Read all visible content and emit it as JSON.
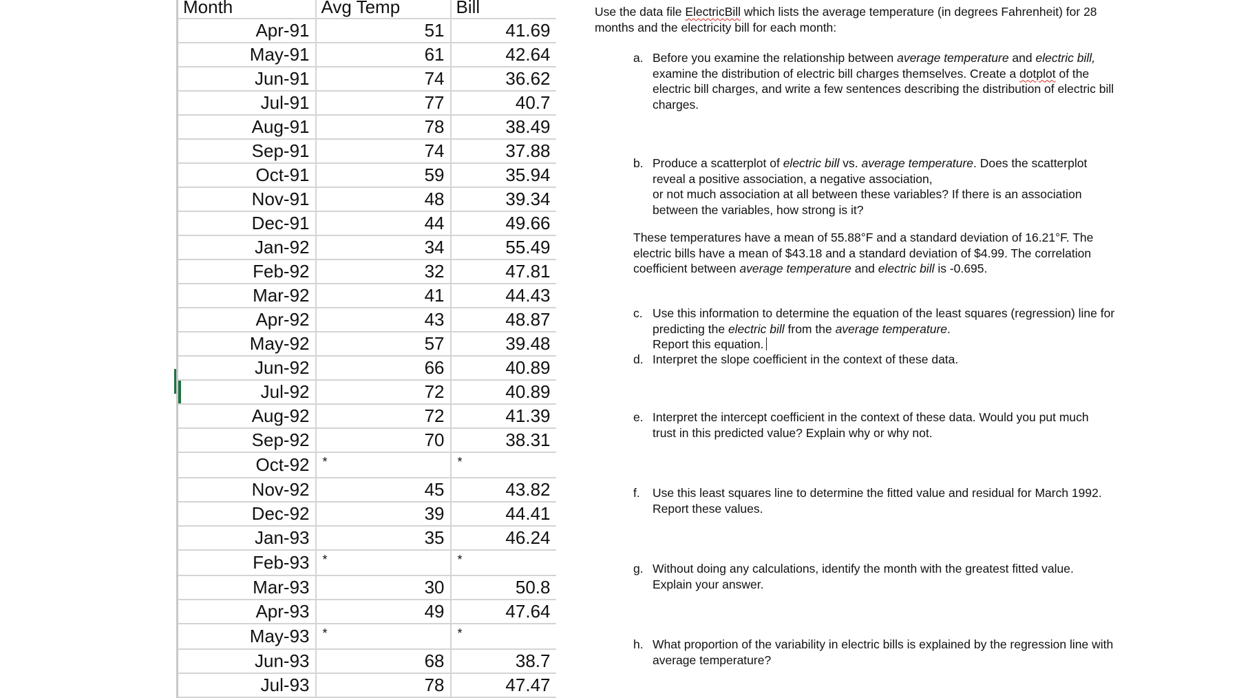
{
  "sheet": {
    "headers": [
      "Month",
      "Avg Temp",
      "Bill"
    ],
    "selected_row": "Jul-92",
    "selection_color": "#1e7145",
    "rows": [
      {
        "month": "Apr-91",
        "temp": "51",
        "bill": "41.69"
      },
      {
        "month": "May-91",
        "temp": "61",
        "bill": "42.64"
      },
      {
        "month": "Jun-91",
        "temp": "74",
        "bill": "36.62"
      },
      {
        "month": "Jul-91",
        "temp": "77",
        "bill": "40.7"
      },
      {
        "month": "Aug-91",
        "temp": "78",
        "bill": "38.49"
      },
      {
        "month": "Sep-91",
        "temp": "74",
        "bill": "37.88"
      },
      {
        "month": "Oct-91",
        "temp": "59",
        "bill": "35.94"
      },
      {
        "month": "Nov-91",
        "temp": "48",
        "bill": "39.34"
      },
      {
        "month": "Dec-91",
        "temp": "44",
        "bill": "49.66"
      },
      {
        "month": "Jan-92",
        "temp": "34",
        "bill": "55.49"
      },
      {
        "month": "Feb-92",
        "temp": "32",
        "bill": "47.81"
      },
      {
        "month": "Mar-92",
        "temp": "41",
        "bill": "44.43"
      },
      {
        "month": "Apr-92",
        "temp": "43",
        "bill": "48.87"
      },
      {
        "month": "May-92",
        "temp": "57",
        "bill": "39.48"
      },
      {
        "month": "Jun-92",
        "temp": "66",
        "bill": "40.89"
      },
      {
        "month": "Jul-92",
        "temp": "72",
        "bill": "40.89"
      },
      {
        "month": "Aug-92",
        "temp": "72",
        "bill": "41.39"
      },
      {
        "month": "Sep-92",
        "temp": "70",
        "bill": "38.31"
      },
      {
        "month": "Oct-92",
        "temp": "*",
        "bill": "*"
      },
      {
        "month": "Nov-92",
        "temp": "45",
        "bill": "43.82"
      },
      {
        "month": "Dec-92",
        "temp": "39",
        "bill": "44.41"
      },
      {
        "month": "Jan-93",
        "temp": "35",
        "bill": "46.24"
      },
      {
        "month": "Feb-93",
        "temp": "*",
        "bill": "*"
      },
      {
        "month": "Mar-93",
        "temp": "30",
        "bill": "50.8"
      },
      {
        "month": "Apr-93",
        "temp": "49",
        "bill": "47.64"
      },
      {
        "month": "May-93",
        "temp": "*",
        "bill": "*"
      },
      {
        "month": "Jun-93",
        "temp": "68",
        "bill": "38.7"
      },
      {
        "month": "Jul-93",
        "temp": "78",
        "bill": "47.47"
      }
    ]
  },
  "doc": {
    "intro": {
      "pre": "Use the data file ",
      "file_name": "ElectricBill",
      "post": " which lists the average temperature (in degrees Fahrenheit) for 28 months and the electricity bill for each month:"
    },
    "q_a": {
      "label": "a.",
      "p1": "Before you examine the relationship between ",
      "i1": "average temperature",
      "p2": " and ",
      "i2": "electric bill,",
      "p3": " examine the distribution of electric bill charges themselves. Create a ",
      "squiggle": "dotplot",
      "p4": " of the electric bill charges, and write a few sentences describing the distribution of electric bill charges."
    },
    "q_b": {
      "label": "b.",
      "p1": "Produce a scatterplot of ",
      "i1": "electric bill",
      "p2": " vs. ",
      "i2": "average temperature",
      "p3": ". Does the scatterplot reveal a positive association, a negative association,",
      "p4": "or not much association at all between these variables? If there is an association between the variables, how strong is it?"
    },
    "stats": {
      "p1": "These temperatures have a mean of 55.88°F and a standard deviation of 16.21°F. The electric bills have a mean of $43.18 and a standard deviation of $4.99. The correlation coefficient between ",
      "i1": "average temperature",
      "p2": " and ",
      "i2": "electric bill",
      "p3": " is -0.695."
    },
    "q_c": {
      "label": "c.",
      "p1": "Use this information to determine the equation of the least squares (regression) line for predicting the ",
      "i1": "electric bill",
      "p2": " from the ",
      "i2": "average temperature",
      "p3": ".",
      "p4": "Report this equation."
    },
    "q_d": {
      "label": "d.",
      "text": "Interpret the slope coefficient in the context of these data."
    },
    "q_e": {
      "label": "e.",
      "text": "Interpret the intercept coefficient in the context of these data. Would you put much trust in this predicted value? Explain why or why not."
    },
    "q_f": {
      "label": "f.",
      "text": "Use this least squares line to determine the fitted value and residual for March 1992. Report these values."
    },
    "q_g": {
      "label": "g.",
      "text": "Without doing any calculations, identify the month with the greatest fitted value. Explain your answer."
    },
    "q_h": {
      "label": "h.",
      "text": "What proportion of the variability in electric bills is explained by the regression line with average temperature?"
    }
  }
}
